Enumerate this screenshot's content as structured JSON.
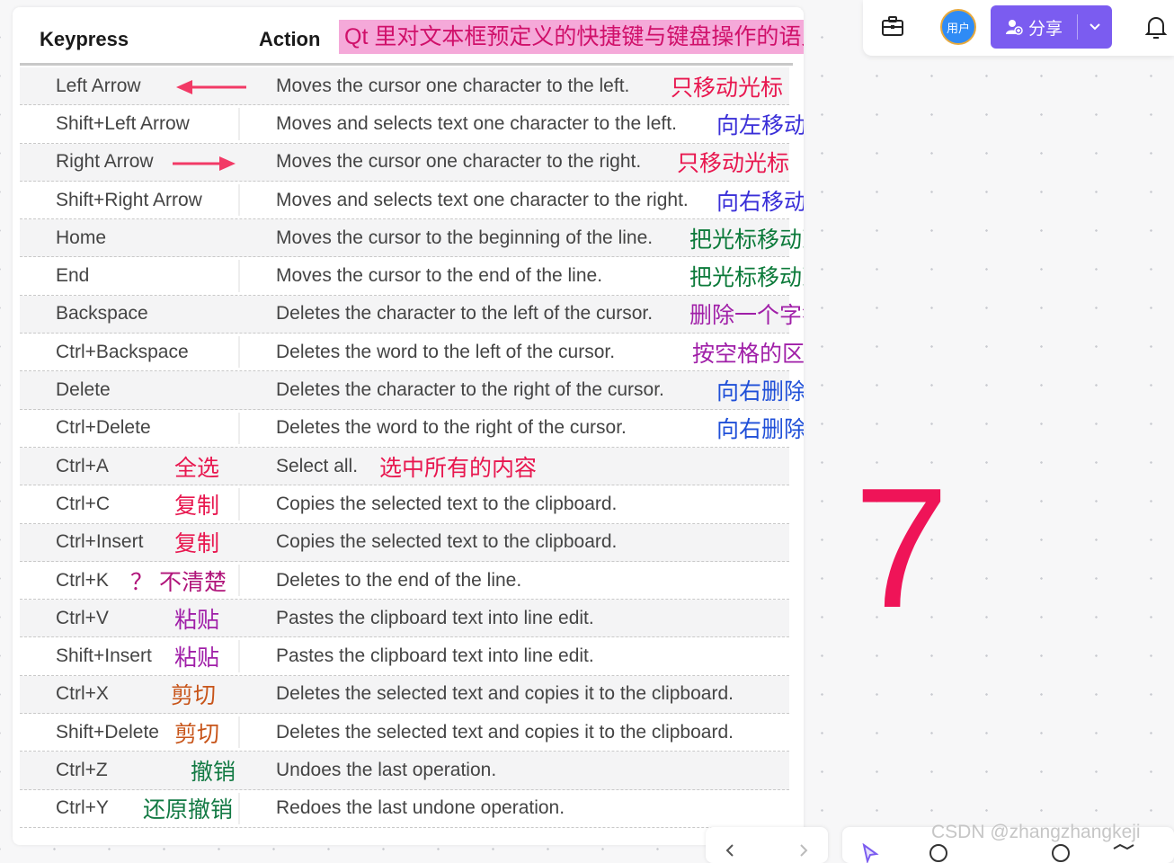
{
  "table": {
    "header": {
      "keypress": "Keypress",
      "action": "Action",
      "note": "Qt 里对文本框预定义的快捷键与键盘操作的语义"
    },
    "rows": [
      {
        "key": "Left Arrow",
        "action": "Moves the cursor one character to the left.",
        "action_note": "只移动光标"
      },
      {
        "key": "Shift+Left Arrow",
        "action": "Moves and selects text one character to the left.",
        "action_note": "向左移动光标并选中文本"
      },
      {
        "key": "Right Arrow",
        "action": "Moves the cursor one character to the right.",
        "action_note": "只移动光标"
      },
      {
        "key": "Shift+Right Arrow",
        "action": "Moves and selects text one character to the right.",
        "action_note": "向右移动光标并选中文本"
      },
      {
        "key": "Home",
        "action": "Moves the cursor to the beginning of the line.",
        "action_note": "把光标移动到行首，所有字符的前面"
      },
      {
        "key": "End",
        "action": "Moves the cursor to the end of the line.",
        "action_note": "把光标移动到末尾，所有字符的后面"
      },
      {
        "key": "Backspace",
        "action": "Deletes the character to the left of the cursor.",
        "action_note": "删除一个字符"
      },
      {
        "key": "Ctrl+Backspace",
        "action": "Deletes the word to the left of the cursor.",
        "action_note": "按空格的区分，删除单词，这对英文才有意义"
      },
      {
        "key": "Delete",
        "action": "Deletes the character to the right of the cursor.",
        "action_note": "向右删除字符"
      },
      {
        "key": "Ctrl+Delete",
        "action": "Deletes the word to the right of the cursor.",
        "action_note": "向右删除单词"
      },
      {
        "key": "Ctrl+A",
        "key_note": "全选",
        "action": "Select all.",
        "action_note": "选中所有的内容"
      },
      {
        "key": "Ctrl+C",
        "key_note": "复制",
        "action": "Copies the selected text to the clipboard."
      },
      {
        "key": "Ctrl+Insert",
        "key_note": "复制",
        "action": "Copies the selected text to the clipboard."
      },
      {
        "key": "Ctrl+K",
        "key_note": "？ 不清楚",
        "action": "Deletes to the end of the line."
      },
      {
        "key": "Ctrl+V",
        "key_note": "粘贴",
        "action": "Pastes the clipboard text into line edit."
      },
      {
        "key": "Shift+Insert",
        "key_note": "粘贴",
        "action": "Pastes the clipboard text into line edit."
      },
      {
        "key": "Ctrl+X",
        "key_note": "剪切",
        "action": "Deletes the selected text and copies it to the clipboard."
      },
      {
        "key": "Shift+Delete",
        "key_note": "剪切",
        "action": "Deletes the selected text and copies it to the clipboard."
      },
      {
        "key": "Ctrl+Z",
        "key_note": "撤销",
        "action": "Undoes the last operation."
      },
      {
        "key": "Ctrl+Y",
        "key_note": "还原撤销",
        "action": "Redoes the last undone operation."
      }
    ]
  },
  "canvas": {
    "big_number": "7",
    "watermark": "CSDN @zhangzhangkeji"
  },
  "toolbar": {
    "avatar_label": "用户",
    "share_label": "分享",
    "icons": [
      "briefcase-icon",
      "add-user-icon",
      "chevron-down-icon",
      "bell-icon"
    ]
  },
  "colors": {
    "accent": "#7b5cf0",
    "annotation_red": "#e8174f",
    "header_note_bg": "#f5a9d9",
    "big_number": "#ef1458"
  }
}
